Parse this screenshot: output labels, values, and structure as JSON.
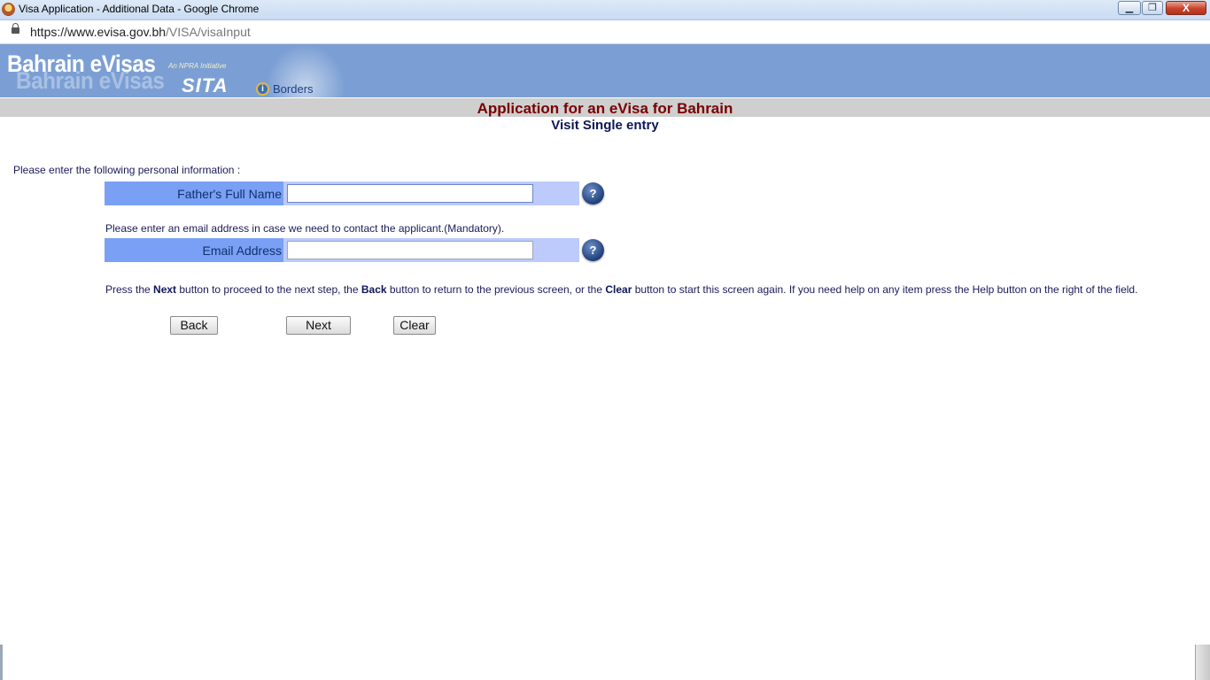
{
  "window": {
    "title": "Visa Application - Additional Data - Google Chrome",
    "minimize": "▁",
    "maximize": "❐",
    "close": "X"
  },
  "address_bar": {
    "url_host": "https://www.evisa.gov.bh",
    "url_path": "/VISA/visaInput"
  },
  "banner": {
    "logo": "Bahrain eVisas",
    "tagline": "An NPRA Initiative",
    "partner1": "SITA",
    "partner2_icon": "i",
    "partner2": "Borders"
  },
  "page": {
    "title": "Application for an eVisa for Bahrain",
    "subtitle": "Visit Single entry"
  },
  "form": {
    "intro": "Please enter the following personal information :",
    "fathers_name_label": "Father's Full Name",
    "fathers_name_value": "",
    "email_note": "Please enter an email address in case we need to contact the applicant.(Mandatory).",
    "email_label": "Email Address",
    "email_value": "",
    "help_label": "?"
  },
  "instructions": {
    "p1": "Press the ",
    "next": "Next",
    "p2": " button to proceed to the next step, the ",
    "back": "Back",
    "p3": " button to return to the previous screen, or the ",
    "clear": "Clear",
    "p4": " button to start this screen again. If you need help on any item press the Help button on the right of the field."
  },
  "buttons": {
    "back": "Back",
    "next": "Next",
    "clear": "Clear"
  }
}
